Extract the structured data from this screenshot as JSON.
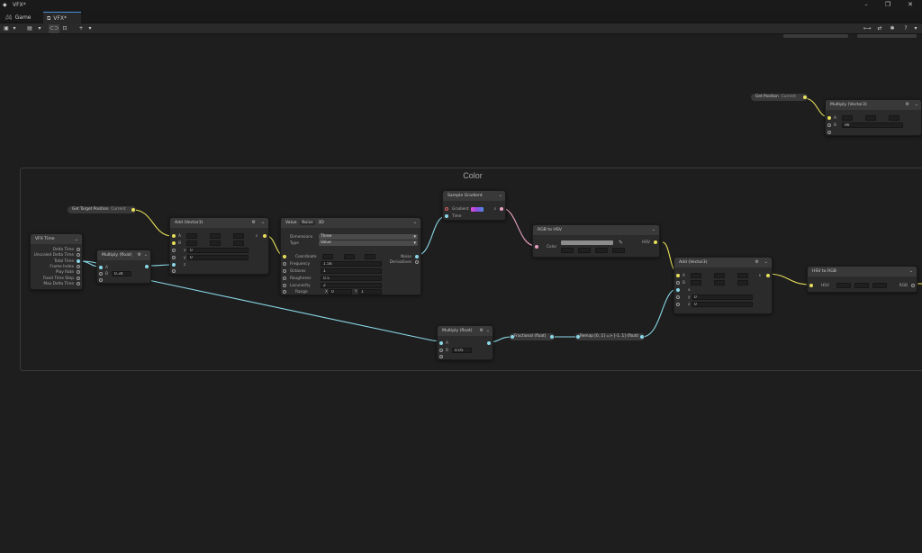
{
  "window": {
    "title": "VFX*",
    "controls": [
      "–",
      "❐",
      "✕"
    ]
  },
  "tabs": [
    {
      "label": "Game",
      "icon": "gamepad-icon"
    },
    {
      "label": "VFX*",
      "icon": "vfx-graph-icon"
    }
  ],
  "group": {
    "title": "Color"
  },
  "nodes": {
    "vfx_time": {
      "title": "VFX Time",
      "outputs": [
        "Delta Time",
        "Unscaled Delta Time",
        "Total Time",
        "Frame Index",
        "Play Rate",
        "Fixed Time Step",
        "Max Delta Time"
      ]
    },
    "multiply1": {
      "title": "Multiply (float)",
      "a_label": "A",
      "b_label": "B",
      "b_value": "0.34"
    },
    "get_target_position": {
      "title": "Get Target Position",
      "space": "Current"
    },
    "add1": {
      "title": "Add (Vector3)",
      "a_label": "A",
      "b_label": "B",
      "x_label": "x",
      "x": "0",
      "y_label": "y",
      "y": "0",
      "z_label": "z",
      "z": "0"
    },
    "noise": {
      "title_prefix": "Value",
      "title_main": "Noise",
      "title_suffix": "3D",
      "dimensions_label": "Dimensions",
      "dimensions": "Three",
      "type_label": "Type",
      "type": "Value",
      "coordinate_label": "Coordinate",
      "frequency_label": "Frequency",
      "frequency": "1.56",
      "octaves_label": "Octaves",
      "octaves": "1",
      "roughness_label": "Roughness",
      "roughness": "0.5",
      "lacunarity_label": "Lacunarity",
      "lacunarity": "2",
      "range_label": "Range",
      "range_x_label": "X",
      "range_x": "0",
      "range_y_label": "Y",
      "range_y": "1",
      "out_noise": "Noise",
      "out_derivatives": "Derivatives"
    },
    "sample_gradient": {
      "title": "Sample Gradient",
      "gradient_label": "Gradient",
      "time_label": "Time",
      "out": "s"
    },
    "rgb_to_hsv": {
      "title": "RGB to HSV",
      "color_label": "Color",
      "out": "HSV"
    },
    "add2": {
      "title": "Add (Vector3)",
      "a_label": "A",
      "b_label": "B",
      "x_label": "x",
      "x": "0",
      "y_label": "y",
      "y": "0",
      "z_label": "z",
      "z": "0"
    },
    "hsv_to_rgb": {
      "title": "HSV to RGB",
      "hsv_label": "HSV",
      "out": "RGB"
    },
    "multiply2": {
      "title": "Multiply (float)",
      "a_label": "A",
      "b_label": "B",
      "b_value": "0.05"
    },
    "fractional": {
      "title": "Fractional (float)"
    },
    "remap": {
      "title": "Remap [0..1] => [-1..1] (float)"
    },
    "get_position": {
      "title": "Get Position",
      "space": "Current"
    },
    "multiply3": {
      "title": "Multiply (Vector3)",
      "a_label": "A",
      "b_label": "B",
      "b_value": "90"
    }
  },
  "colors": {
    "wire_float": "#8ad8e8",
    "wire_vector": "#e8e05a",
    "wire_gradient": "#e8a0c0"
  }
}
